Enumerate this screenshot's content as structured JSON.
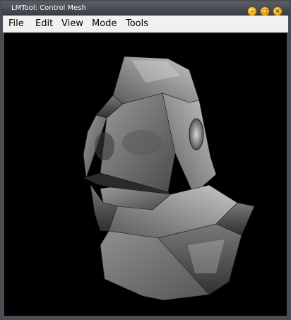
{
  "window": {
    "title": "LMTool: Control Mesh",
    "buttons": [
      "minimize-button",
      "maximize-button",
      "close-button"
    ]
  },
  "menubar": {
    "items": [
      {
        "label": "File"
      },
      {
        "label": "Edit"
      },
      {
        "label": "View"
      },
      {
        "label": "Mode"
      },
      {
        "label": "Tools"
      }
    ]
  },
  "colors": {
    "frame": "#4a4c54",
    "titlebar": "#3a3c44",
    "menubar": "#f2f1ef",
    "viewport_background": "#000000",
    "button_accent": "#f0b020"
  }
}
